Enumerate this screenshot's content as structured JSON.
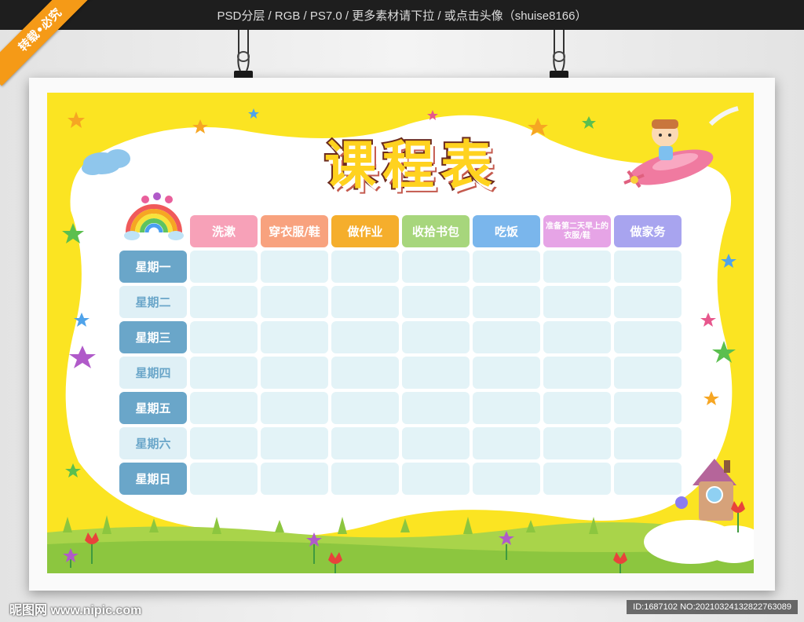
{
  "top_banner": {
    "text": "PSD分层 / RGB / PS7.0 / 更多素材请下拉 / 或点击头像（shuise8166）"
  },
  "ribbon": {
    "text": "转载•必究"
  },
  "poster": {
    "title_chars": [
      "课",
      "程",
      "表"
    ],
    "colors": {
      "background": "#fbe422",
      "panel": "#ffffff",
      "cell": "#e3f3f7",
      "day_dark": "#6aa6c9",
      "day_light": "#dff0f6"
    },
    "columns": [
      {
        "label": "洗漱",
        "color": "#f7a1b8"
      },
      {
        "label": "穿衣服/鞋",
        "color": "#f8a27e"
      },
      {
        "label": "做作业",
        "color": "#f5ae2c"
      },
      {
        "label": "收拾书包",
        "color": "#a7d67c"
      },
      {
        "label": "吃饭",
        "color": "#7ab6ec"
      },
      {
        "label": "准备第二天早上的衣服/鞋",
        "color": "#e6a4e6"
      },
      {
        "label": "做家务",
        "color": "#a8a4ef"
      }
    ],
    "days": [
      {
        "label": "星期一",
        "style": "dark"
      },
      {
        "label": "星期二",
        "style": "light"
      },
      {
        "label": "星期三",
        "style": "dark"
      },
      {
        "label": "星期四",
        "style": "light"
      },
      {
        "label": "星期五",
        "style": "dark"
      },
      {
        "label": "星期六",
        "style": "light"
      },
      {
        "label": "星期日",
        "style": "dark"
      }
    ]
  },
  "footer": {
    "site_watermark": "昵图网 www.nipic.com",
    "id_watermark": "ID:1687102 NO:20210324132822763089"
  },
  "decorations": [
    "binder-clip-icon",
    "cloud-icon",
    "rainbow-icon",
    "airplane-icon",
    "house-icon",
    "star-icon",
    "tulip-icon",
    "grass-icon"
  ]
}
